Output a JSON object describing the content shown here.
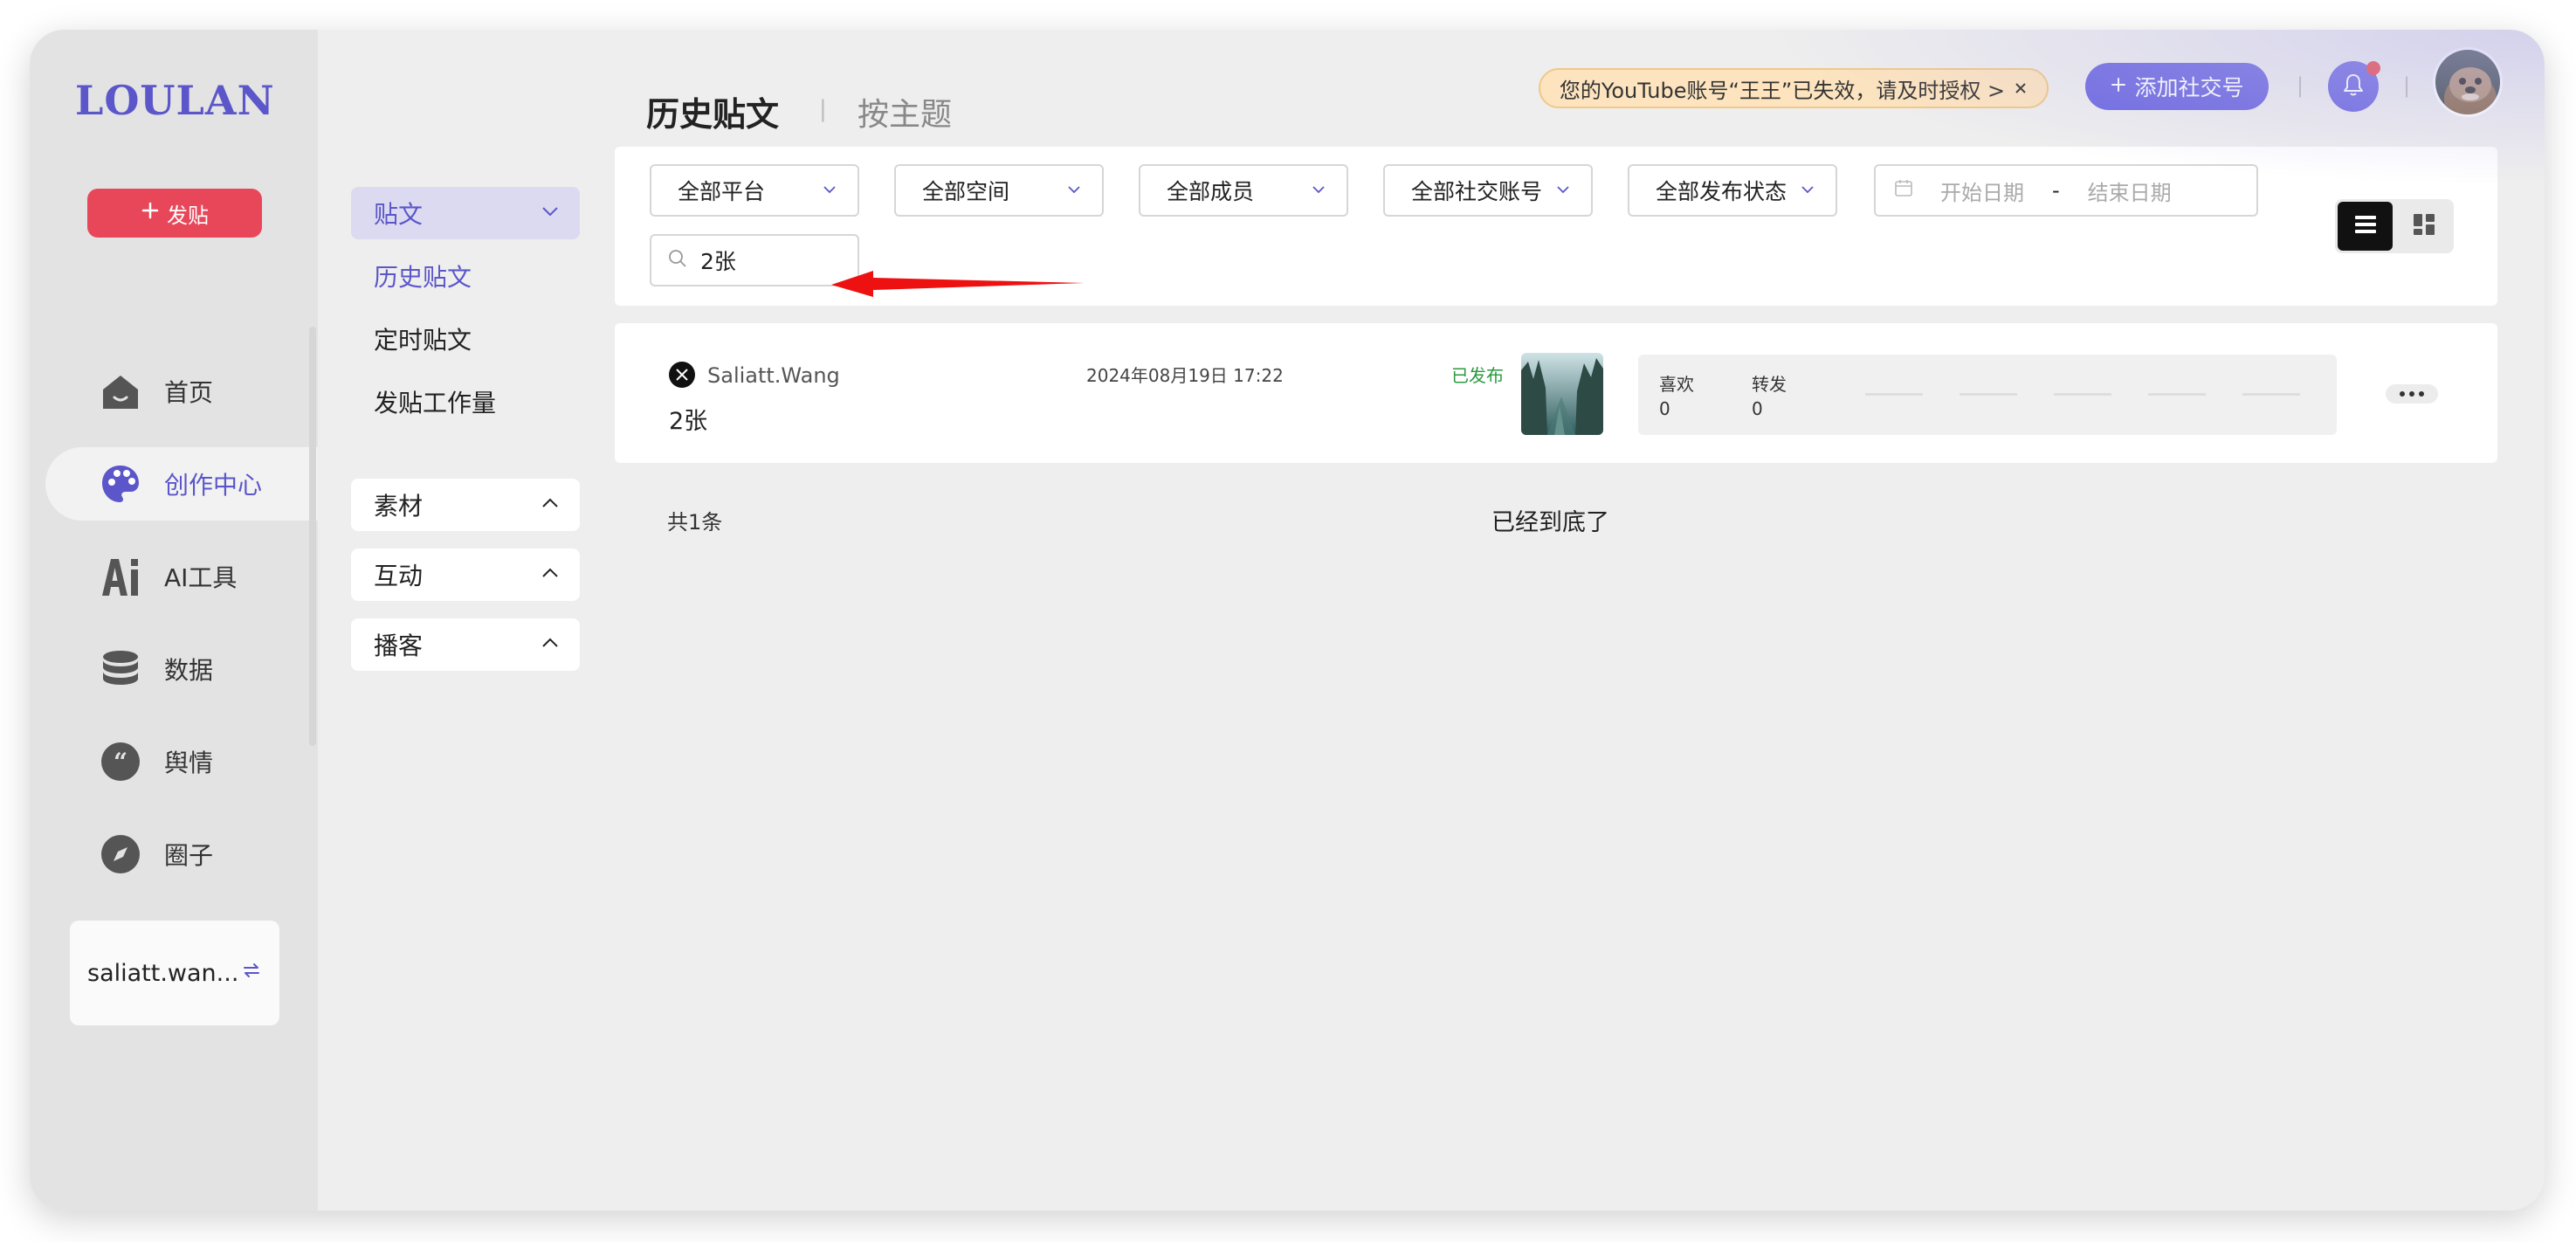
{
  "app": {
    "logo": "LOULAN"
  },
  "sidebar": {
    "post_button": "发贴",
    "items": [
      {
        "label": "首页",
        "icon": "home-icon"
      },
      {
        "label": "创作中心",
        "icon": "palette-icon",
        "active": true
      },
      {
        "label": "AI工具",
        "icon": "ai-icon"
      },
      {
        "label": "数据",
        "icon": "database-icon"
      },
      {
        "label": "舆情",
        "icon": "quote-icon"
      },
      {
        "label": "圈子",
        "icon": "compass-icon"
      }
    ],
    "account": "saliatt.wan..."
  },
  "submenu": {
    "posts_group": "贴文",
    "posts_items": [
      "历史贴文",
      "定时贴文",
      "发贴工作量"
    ],
    "material": "素材",
    "interaction": "互动",
    "podcast": "播客"
  },
  "header": {
    "tab_history": "历史贴文",
    "tab_sep": "|",
    "tab_topic": "按主题",
    "notice": "您的YouTube账号“王王”已失效，请及时授权 >",
    "add_social": "添加社交号"
  },
  "filters": {
    "platform": "全部平台",
    "space": "全部空间",
    "member": "全部成员",
    "social_account": "全部社交账号",
    "publish_status": "全部发布状态",
    "start_date": "开始日期",
    "date_sep": "-",
    "end_date": "结束日期",
    "search_value": "2张"
  },
  "post": {
    "author": "Saliatt.Wang",
    "text": "2张",
    "time": "2024年08月19日 17:22",
    "status": "已发布",
    "likes_label": "喜欢",
    "likes": "0",
    "reposts_label": "转发",
    "reposts": "0"
  },
  "footer": {
    "total": "共1条",
    "end_message": "已经到底了"
  },
  "colors": {
    "accent": "#5b56c9",
    "post_button": "#e8475a",
    "add_button": "#6d68e0",
    "status_published": "#2b9a3f",
    "notice_bg": "#fde4bf",
    "arrow": "#ee1111"
  }
}
